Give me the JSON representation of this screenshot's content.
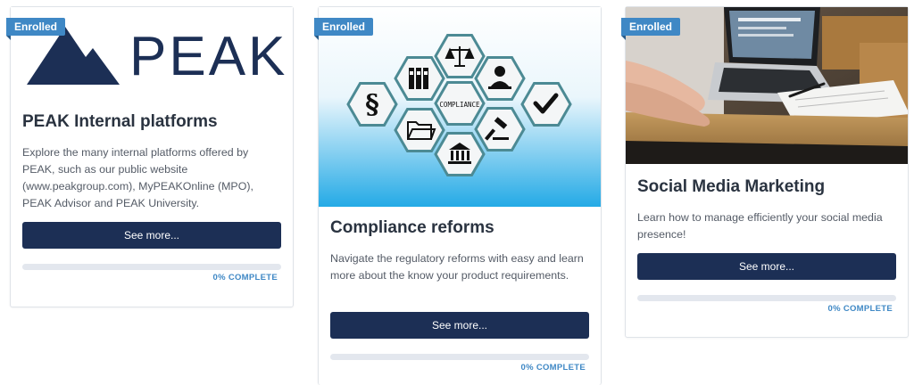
{
  "courses": [
    {
      "badge": "Enrolled",
      "logo_text": "PEAK",
      "title": "PEAK Internal platforms",
      "description": "Explore the many internal platforms offered by PEAK, such as our public website (www.peakgroup.com), MyPEAKOnline (MPO), PEAK Advisor and PEAK University.",
      "button": "See more...",
      "progress": 0,
      "progress_label": "0% COMPLETE"
    },
    {
      "badge": "Enrolled",
      "image_label": "COMPLIANCE",
      "title": "Compliance reforms",
      "description": "Navigate the regulatory reforms with easy and learn more about the know your product requirements.",
      "button": "See more...",
      "progress": 0,
      "progress_label": "0% COMPLETE"
    },
    {
      "badge": "Enrolled",
      "title": "Social Media Marketing",
      "description": "Learn how to manage efficiently your social media presence!",
      "button": "See more...",
      "progress": 0,
      "progress_label": "0% COMPLETE"
    }
  ],
  "colors": {
    "badge": "#3f88c5",
    "button": "#1c2f55",
    "logo": "#1c2f55",
    "progress_track": "#e3e7ee"
  }
}
